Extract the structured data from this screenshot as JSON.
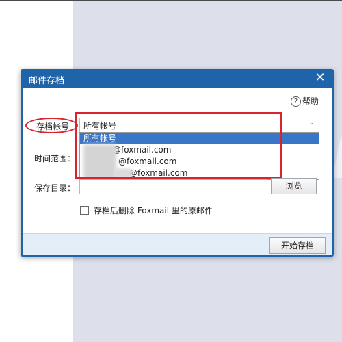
{
  "dialog": {
    "title": "邮件存档",
    "close_glyph": "✕",
    "help": "帮助",
    "help_glyph": "?"
  },
  "form": {
    "account_label": "存档帐号",
    "account_selected": "所有帐号",
    "time_label": "时间范围：",
    "dir_label": "保存目录：",
    "browse": "浏览",
    "delete_after_archive": "存档后删除 Foxmail 里的原邮件",
    "delete_checked": false
  },
  "dropdown": {
    "items": [
      "所有帐号",
      "@foxmail.com",
      "@foxmail.com",
      "@foxmail.com"
    ],
    "selected_index": 0
  },
  "footer": {
    "start": "开始存档"
  },
  "colors": {
    "dialog_frame": "#1f63a8",
    "selection": "#3a76c8",
    "annotation_red": "#d9232d",
    "footer_bg": "#e4eef9"
  }
}
